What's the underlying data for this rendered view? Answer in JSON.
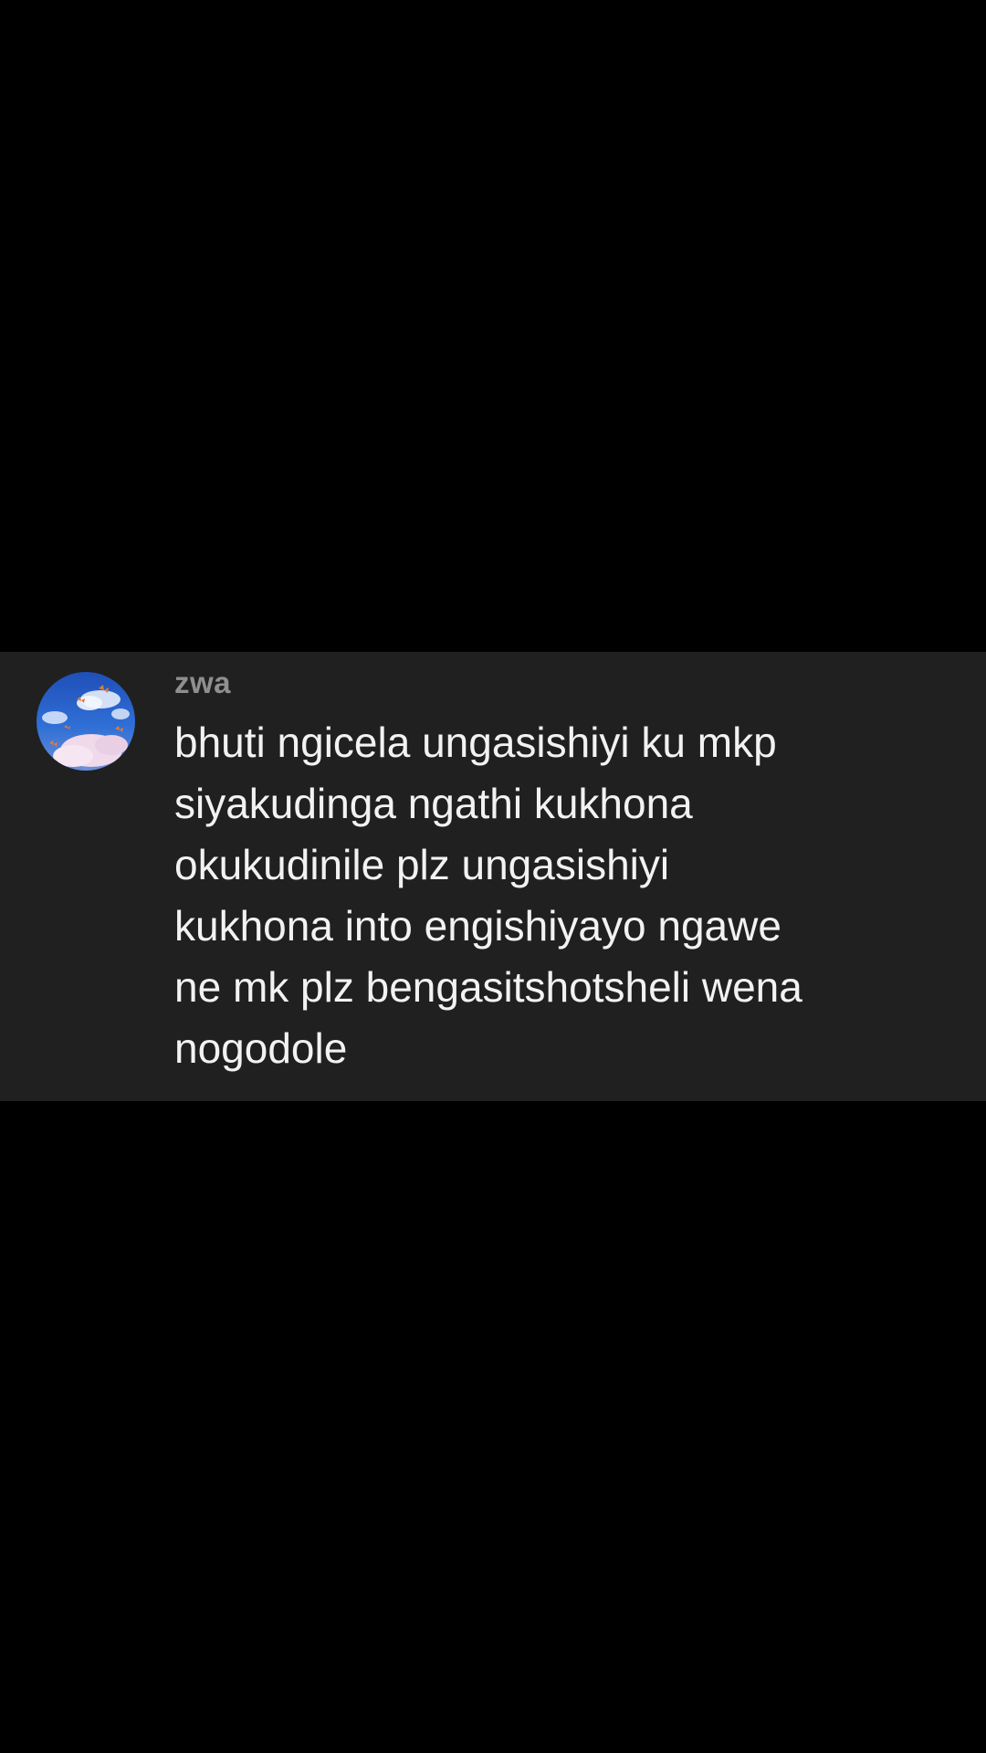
{
  "comment": {
    "username": "zwa",
    "text_lines": [
      "bhuti ngicela ungasishiyi ku mkp",
      "siyakudinga ngathi kukhona",
      "okukudinile plz ungasishiyi",
      "kukhona into engishiyayo ngawe",
      "ne mk plz bengasitshotsheli wena",
      "nogodole"
    ],
    "avatar_icon": "sky-clouds-butterflies-avatar"
  },
  "colors": {
    "background": "#000000",
    "card_background": "#202020",
    "username": "#8f8f8f",
    "text": "#f2f2f2"
  }
}
